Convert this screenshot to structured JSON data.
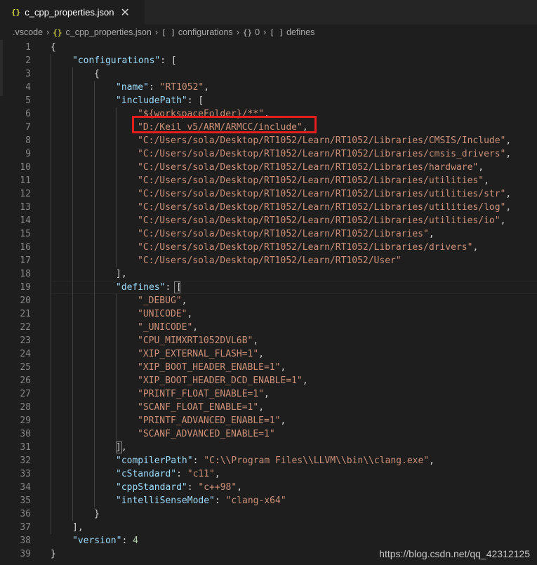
{
  "tab": {
    "icon": "{}",
    "filename": "c_cpp_properties.json",
    "close": "✕"
  },
  "breadcrumb": {
    "folder": ".vscode",
    "file_icon": "{}",
    "file": "c_cpp_properties.json",
    "b1_icon": "[ ]",
    "b1": "configurations",
    "b2_icon": "{}",
    "b2": "0",
    "b3_icon": "[ ]",
    "b3": "defines",
    "sep": "›"
  },
  "code": {
    "lines": [
      "{",
      "\"configurations\": [",
      "{",
      "\"name\": \"RT1052\",",
      "\"includePath\": [",
      "\"${workspaceFolder}/**\",",
      "\"D:/Keil_v5/ARM/ARMCC/include\",",
      "\"C:/Users/sola/Desktop/RT1052/Learn/RT1052/Libraries/CMSIS/Include\",",
      "\"C:/Users/sola/Desktop/RT1052/Learn/RT1052/Libraries/cmsis_drivers\",",
      "\"C:/Users/sola/Desktop/RT1052/Learn/RT1052/Libraries/hardware\",",
      "\"C:/Users/sola/Desktop/RT1052/Learn/RT1052/Libraries/utilities\",",
      "\"C:/Users/sola/Desktop/RT1052/Learn/RT1052/Libraries/utilities/str\",",
      "\"C:/Users/sola/Desktop/RT1052/Learn/RT1052/Libraries/utilities/log\",",
      "\"C:/Users/sola/Desktop/RT1052/Learn/RT1052/Libraries/utilities/io\",",
      "\"C:/Users/sola/Desktop/RT1052/Learn/RT1052/Libraries\",",
      "\"C:/Users/sola/Desktop/RT1052/Learn/RT1052/Libraries/drivers\",",
      "\"C:/Users/sola/Desktop/RT1052/Learn/RT1052/User\"",
      "],",
      "\"defines\": [",
      "\"_DEBUG\",",
      "\"UNICODE\",",
      "\"_UNICODE\",",
      "\"CPU_MIMXRT1052DVL6B\",",
      "\"XIP_EXTERNAL_FLASH=1\",",
      "\"XIP_BOOT_HEADER_ENABLE=1\",",
      "\"XIP_BOOT_HEADER_DCD_ENABLE=1\",",
      "\"PRINTF_FLOAT_ENABLE=1\",",
      "\"SCANF_FLOAT_ENABLE=1\",",
      "\"PRINTF_ADVANCED_ENABLE=1\",",
      "\"SCANF_ADVANCED_ENABLE=1\"",
      "],",
      "\"compilerPath\": \"C:\\\\Program Files\\\\LLVM\\\\bin\\\\clang.exe\",",
      "\"cStandard\": \"c11\",",
      "\"cppStandard\": \"c++98\",",
      "\"intelliSenseMode\": \"clang-x64\"",
      "}",
      "],",
      "\"version\": 4",
      "}"
    ]
  },
  "watermark": "https://blog.csdn.net/qq_42312125",
  "colors": {
    "background": "#1e1e1e",
    "key": "#9cdcfe",
    "string": "#ce9178",
    "number": "#b5cea8",
    "punct": "#d4d4d4",
    "line_number": "#858585",
    "highlight_box": "#e51d1d",
    "json_icon": "#cbcb41"
  }
}
